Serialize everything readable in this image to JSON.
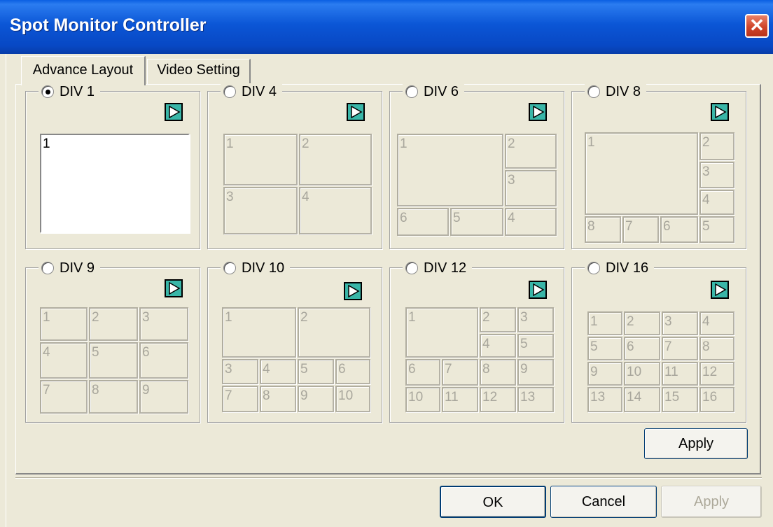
{
  "window": {
    "title": "Spot Monitor Controller",
    "close_icon": "close-icon"
  },
  "tabs": [
    {
      "label": "Advance Layout",
      "active": true
    },
    {
      "label": "Video Setting",
      "active": false
    }
  ],
  "layouts": [
    {
      "label": "DIV 1",
      "selected": true,
      "cells": [
        "1"
      ]
    },
    {
      "label": "DIV 4",
      "selected": false,
      "cells": [
        "1",
        "2",
        "3",
        "4"
      ]
    },
    {
      "label": "DIV 6",
      "selected": false,
      "cells": [
        "1",
        "2",
        "3",
        "4",
        "5",
        "6"
      ]
    },
    {
      "label": "DIV 8",
      "selected": false,
      "cells": [
        "1",
        "2",
        "3",
        "4",
        "5",
        "6",
        "7",
        "8"
      ]
    },
    {
      "label": "DIV 9",
      "selected": false,
      "cells": [
        "1",
        "2",
        "3",
        "4",
        "5",
        "6",
        "7",
        "8",
        "9"
      ]
    },
    {
      "label": "DIV 10",
      "selected": false,
      "cells": [
        "1",
        "2",
        "3",
        "4",
        "5",
        "6",
        "7",
        "8",
        "9",
        "10"
      ]
    },
    {
      "label": "DIV 12",
      "selected": false,
      "cells": [
        "1",
        "2",
        "3",
        "4",
        "5",
        "6",
        "7",
        "8",
        "9",
        "10",
        "11",
        "12",
        "13"
      ]
    },
    {
      "label": "DIV 16",
      "selected": false,
      "cells": [
        "1",
        "2",
        "3",
        "4",
        "5",
        "6",
        "7",
        "8",
        "9",
        "10",
        "11",
        "12",
        "13",
        "14",
        "15",
        "16"
      ]
    }
  ],
  "apply_tab_label": "Apply",
  "footer": {
    "ok_label": "OK",
    "cancel_label": "Cancel",
    "apply_label": "Apply",
    "apply_disabled": true
  },
  "colors": {
    "title_bar": "#0a56d6",
    "play_button": "#39b6a8",
    "close_button": "#d0452a",
    "face": "#ece9d8"
  }
}
